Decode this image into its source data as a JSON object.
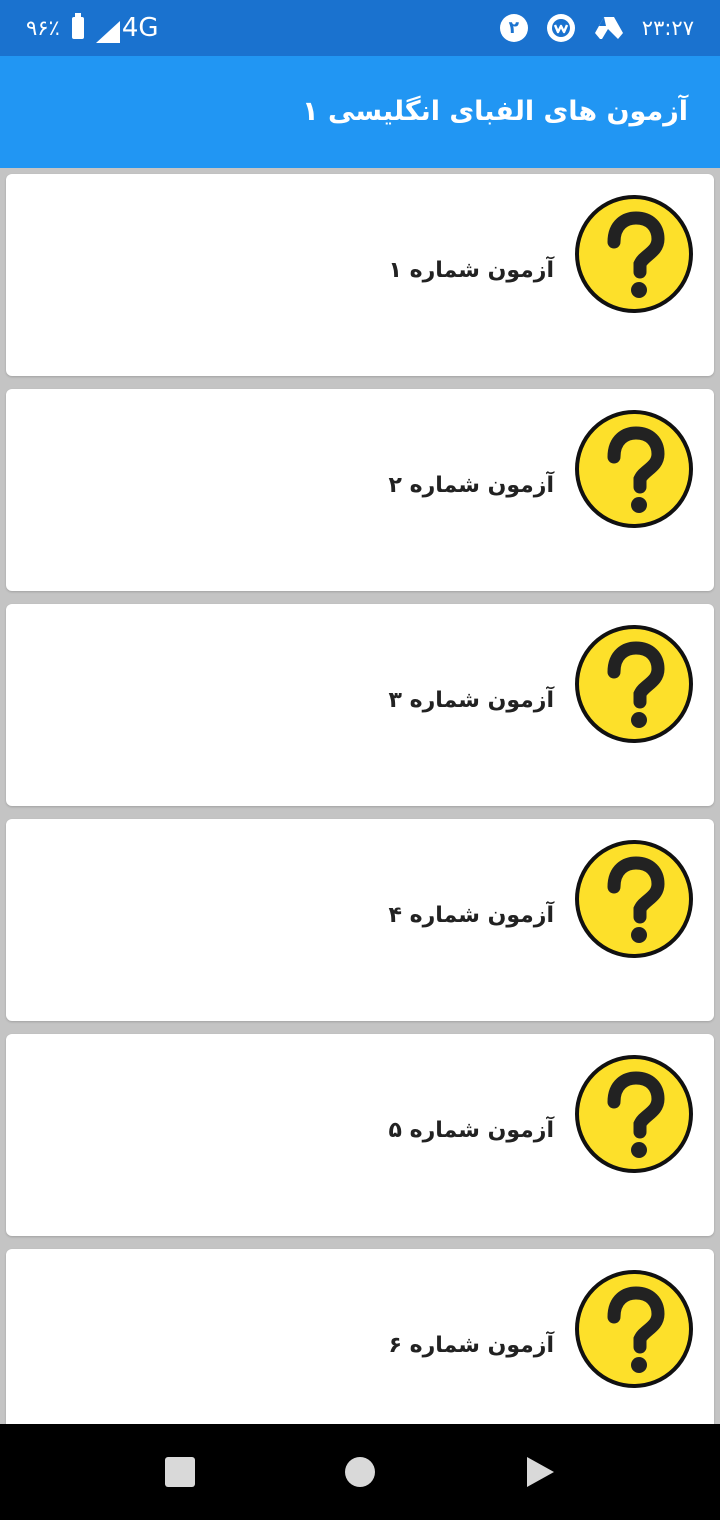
{
  "status_bar": {
    "battery_percent": "۹۶٪",
    "network": "4G",
    "notification_count": "۲",
    "time": "۲۳:۲۷",
    "icons": [
      "battery-icon",
      "signal-icon",
      "notification-badge",
      "app-notification-icon",
      "drive-icon"
    ]
  },
  "app_bar": {
    "title": "آزمون های الفبای انگلیسی ۱",
    "color": "#2196f3"
  },
  "quiz_list": {
    "items": [
      {
        "label": "آزمون شماره ۱",
        "icon": "question-mark-icon"
      },
      {
        "label": "آزمون شماره ۲",
        "icon": "question-mark-icon"
      },
      {
        "label": "آزمون شماره ۳",
        "icon": "question-mark-icon"
      },
      {
        "label": "آزمون شماره ۴",
        "icon": "question-mark-icon"
      },
      {
        "label": "آزمون شماره ۵",
        "icon": "question-mark-icon"
      },
      {
        "label": "آزمون شماره ۶",
        "icon": "question-mark-icon"
      }
    ],
    "icon_color": "#fde02a"
  },
  "nav_bar": {
    "buttons": [
      "recents-button",
      "home-button",
      "back-button"
    ]
  }
}
